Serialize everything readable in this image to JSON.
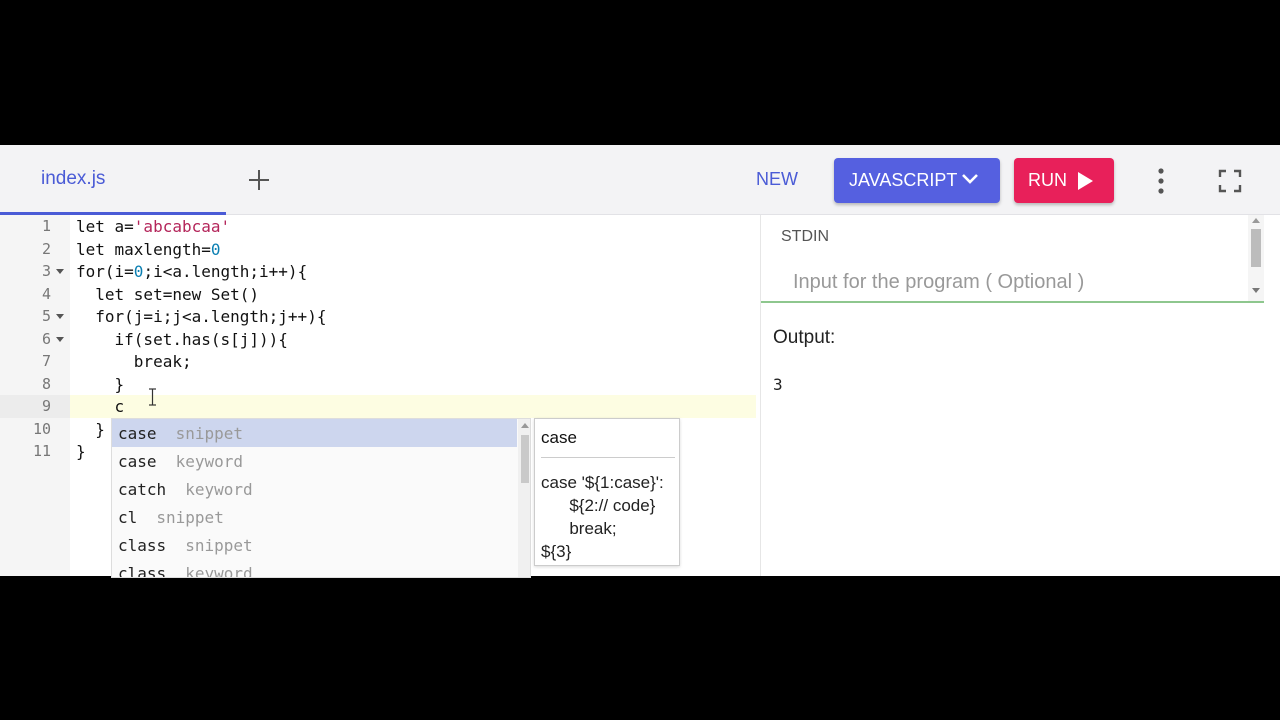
{
  "tabs": [
    {
      "label": "index.js"
    }
  ],
  "toolbar": {
    "new_label": "NEW",
    "language_label": "JAVASCRIPT",
    "run_label": "RUN",
    "accent_color": "#4a5bd6",
    "run_color": "#e8205a"
  },
  "editor": {
    "active_line": 9,
    "lines": [
      {
        "num": "1",
        "segments": [
          {
            "t": "let a=",
            "c": ""
          },
          {
            "t": "'abcabcaa'",
            "c": "str"
          }
        ]
      },
      {
        "num": "2",
        "segments": [
          {
            "t": "let maxlength=",
            "c": ""
          },
          {
            "t": "0",
            "c": "num-lit"
          }
        ]
      },
      {
        "num": "3",
        "segments": [
          {
            "t": "for(i=",
            "c": ""
          },
          {
            "t": "0",
            "c": "num-lit"
          },
          {
            "t": ";i<a.length;i++){",
            "c": ""
          }
        ],
        "fold": true
      },
      {
        "num": "4",
        "segments": [
          {
            "t": "  let set=new Set()",
            "c": ""
          }
        ]
      },
      {
        "num": "5",
        "segments": [
          {
            "t": "  for(j=i;j<a.length;j++){",
            "c": ""
          }
        ],
        "fold": true
      },
      {
        "num": "6",
        "segments": [
          {
            "t": "    if(set.has(s[j])){",
            "c": ""
          }
        ],
        "fold": true
      },
      {
        "num": "7",
        "segments": [
          {
            "t": "      break;",
            "c": ""
          }
        ]
      },
      {
        "num": "8",
        "segments": [
          {
            "t": "    }",
            "c": ""
          }
        ]
      },
      {
        "num": "9",
        "segments": [
          {
            "t": "    c",
            "c": ""
          }
        ]
      },
      {
        "num": "10",
        "segments": [
          {
            "t": "  }",
            "c": ""
          }
        ]
      },
      {
        "num": "11",
        "segments": [
          {
            "t": "}",
            "c": ""
          }
        ]
      }
    ]
  },
  "autocomplete": {
    "items": [
      {
        "keyword": "case",
        "type": "snippet"
      },
      {
        "keyword": "case",
        "type": "keyword"
      },
      {
        "keyword": "catch",
        "type": "keyword"
      },
      {
        "keyword": "cl",
        "type": "snippet"
      },
      {
        "keyword": "class",
        "type": "snippet"
      },
      {
        "keyword": "class",
        "type": "keyword"
      }
    ],
    "selected_index": 0,
    "doc": {
      "title": "case",
      "body": "case '${1:case}':\n      ${2:// code}\n      break;\n${3}"
    }
  },
  "stdin": {
    "label": "STDIN",
    "placeholder": "Input for the program ( Optional )",
    "value": ""
  },
  "output": {
    "label": "Output:",
    "value": "3"
  }
}
